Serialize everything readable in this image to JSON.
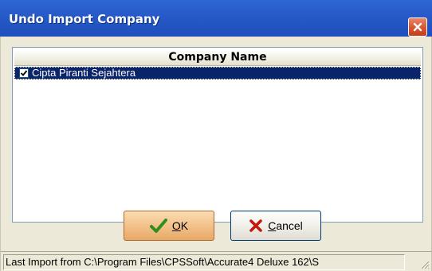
{
  "window": {
    "title": "Undo Import Company"
  },
  "grid": {
    "header": "Company Name",
    "rows": [
      {
        "checked": true,
        "name": "Cipta Piranti Sejahtera"
      }
    ]
  },
  "buttons": {
    "ok_mnemonic": "O",
    "ok_rest": "K",
    "cancel_mnemonic": "C",
    "cancel_rest": "ancel"
  },
  "status": {
    "text": "Last Import from C:\\Program Files\\CPSSoft\\Accurate4 Deluxe 162\\S"
  },
  "icons": {
    "close": "close-icon",
    "ok": "checkmark-icon",
    "cancel": "x-icon",
    "checkbox": "checkbox-checked-icon",
    "grip": "resize-grip-icon"
  },
  "colors": {
    "titlebar": "#2659c7",
    "selection": "#0a246a",
    "ok_button": "#f3c28b",
    "checkmark": "#2f8f1e",
    "cancel_x": "#c41a0e"
  }
}
